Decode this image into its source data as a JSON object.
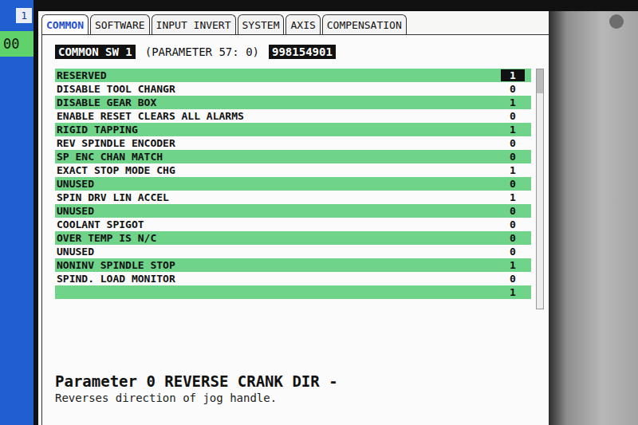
{
  "side_panel": {
    "tab": "1",
    "value": "00"
  },
  "tabs": [
    {
      "label": "COMMON",
      "selected": true
    },
    {
      "label": "SOFTWARE",
      "selected": false
    },
    {
      "label": "INPUT INVERT",
      "selected": false
    },
    {
      "label": "SYSTEM",
      "selected": false
    },
    {
      "label": "AXIS",
      "selected": false
    },
    {
      "label": "COMPENSATION",
      "selected": false
    }
  ],
  "header": {
    "title": "COMMON SW 1",
    "parameter": "(PARAMETER 57: 0)",
    "value": "998154901"
  },
  "rows": [
    {
      "label": "RESERVED",
      "value": "1",
      "selected": true
    },
    {
      "label": "DISABLE TOOL CHANGR",
      "value": "0",
      "selected": false
    },
    {
      "label": "DISABLE GEAR BOX",
      "value": "1",
      "selected": false
    },
    {
      "label": "ENABLE RESET CLEARS ALL ALARMS",
      "value": "0",
      "selected": false
    },
    {
      "label": "RIGID TAPPING",
      "value": "1",
      "selected": false
    },
    {
      "label": "REV SPINDLE ENCODER",
      "value": "0",
      "selected": false
    },
    {
      "label": "SP ENC CHAN MATCH",
      "value": "0",
      "selected": false
    },
    {
      "label": "EXACT STOP MODE CHG",
      "value": "1",
      "selected": false
    },
    {
      "label": "UNUSED",
      "value": "0",
      "selected": false
    },
    {
      "label": "SPIN DRV LIN ACCEL",
      "value": "1",
      "selected": false
    },
    {
      "label": "UNUSED",
      "value": "0",
      "selected": false
    },
    {
      "label": "COOLANT SPIGOT",
      "value": "0",
      "selected": false
    },
    {
      "label": "OVER TEMP IS N/C",
      "value": "0",
      "selected": false
    },
    {
      "label": "UNUSED",
      "value": "0",
      "selected": false
    },
    {
      "label": "NONINV SPINDLE STOP",
      "value": "1",
      "selected": false
    },
    {
      "label": "SPIND. LOAD MONITOR",
      "value": "0",
      "selected": false
    },
    {
      "label": "",
      "value": "1",
      "selected": false
    }
  ],
  "help": {
    "title": "Parameter 0 REVERSE CRANK DIR -",
    "text": "Reverses direction of jog handle."
  }
}
